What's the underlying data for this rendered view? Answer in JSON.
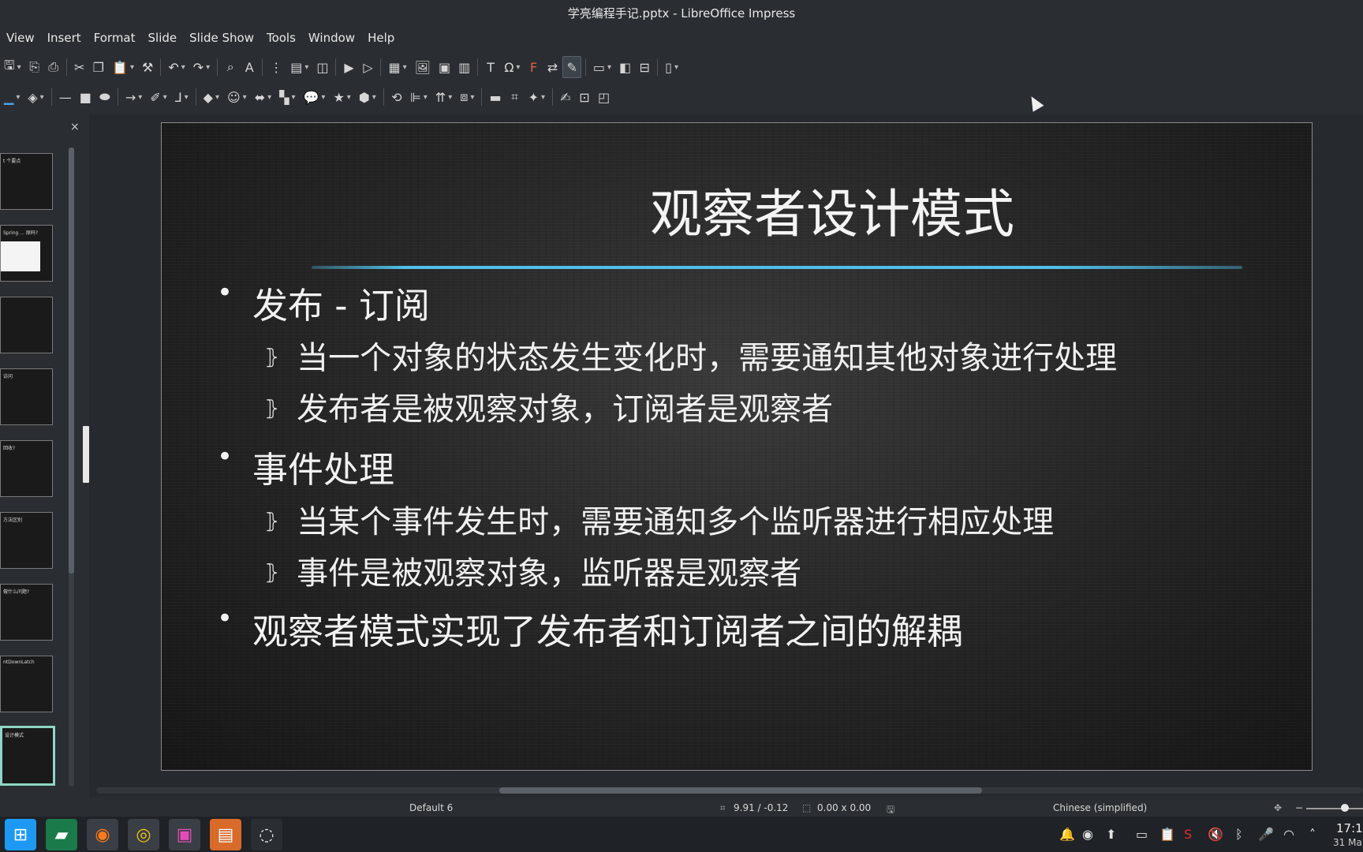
{
  "window": {
    "title": "学亮编程手记.pptx - LibreOffice Impress"
  },
  "menubar": [
    "View",
    "Insert",
    "Format",
    "Slide",
    "Slide Show",
    "Tools",
    "Window",
    "Help"
  ],
  "panel": {
    "close_glyph": "×",
    "thumbnails": [
      {
        "text": "t 个要点"
      },
      {
        "text": "Spring ... 原码?"
      },
      {
        "text": ""
      },
      {
        "text": "访问"
      },
      {
        "text": "回收?"
      },
      {
        "text": "方法区别"
      },
      {
        "text": "做什么问题?"
      },
      {
        "text": "ntDownLatch"
      },
      {
        "text": "设计模式",
        "selected": true
      }
    ]
  },
  "slide": {
    "title": "观察者设计模式",
    "bullets": [
      {
        "level": 1,
        "text": "发布 - 订阅"
      },
      {
        "level": 2,
        "text": "当一个对象的状态发生变化时，需要通知其他对象进行处理"
      },
      {
        "level": 2,
        "text": "发布者是被观察对象，订阅者是观察者"
      },
      {
        "level": 1,
        "text": "事件处理"
      },
      {
        "level": 2,
        "text": "当某个事件发生时，需要通知多个监听器进行相应处理"
      },
      {
        "level": 2,
        "text": "事件是被观察对象，监听器是观察者"
      },
      {
        "level": 1,
        "text": "观察者模式实现了发布者和订阅者之间的解耦"
      }
    ],
    "sub_bullet_mark": "⦄",
    "underline_color": "#4fc0e8"
  },
  "statusbar": {
    "layout": "Default 6",
    "position": "9.91 / -0.12",
    "size": "0.00 x 0.00",
    "language": "Chinese (simplified)",
    "zoom_minus": "−"
  },
  "taskbar": {
    "clock_time": "17:1",
    "clock_date": "31 Ma"
  }
}
